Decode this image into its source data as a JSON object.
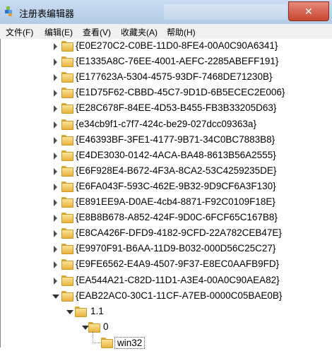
{
  "window": {
    "title": "注册表编辑器",
    "close_glyph": "✕"
  },
  "menu": [
    "文件(F)",
    "编辑(E)",
    "查看(V)",
    "收藏夹(A)",
    "帮助(H)"
  ],
  "tree": {
    "keys": [
      "{E0E270C2-C0BE-11D0-8FE4-00A0C90A6341}",
      "{E1335A8C-76EE-4001-AEFC-2285ABEFF191}",
      "{E177623A-5304-4575-93DF-7468DE71230B}",
      "{E1D75F62-CBBD-45C7-9D1D-6B5ECEC2E006}",
      "{E28C678F-84EE-4D53-B455-FB3B33205D63}",
      "{e34cb9f1-c7f7-424c-be29-027dcc09363a}",
      "{E46393BF-3FE1-4177-9B71-34C0BC7883B8}",
      "{E4DE3030-0142-4ACA-BA48-8613B56A2555}",
      "{E6F928E4-B672-4F3A-8CA2-53C4259235DE}",
      "{E6FA043F-593C-462E-9B32-9D9CF6A3F130}",
      "{E891EE9A-D0AE-4cb4-8871-F92C0109F18E}",
      "{E8B8B678-A852-424F-9D0C-6FCF65C167B8}",
      "{E8CA426F-DFD9-4182-9CFD-22A782CEB47E}",
      "{E9970F91-B6AA-11D9-B032-000D56C25C27}",
      "{E9FE6562-E4A9-4507-9F37-E8EC0AAFB9FD}",
      "{EA544A21-C82D-11D1-A3E4-00A0C90AEA82}",
      "{EAB22AC0-30C1-11CF-A7EB-0000C05BAE0B}"
    ],
    "sub1": "1.1",
    "sub2": "0",
    "sub3": "win32"
  }
}
